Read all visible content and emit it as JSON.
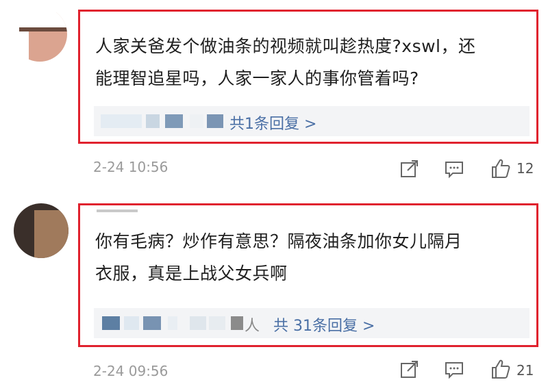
{
  "comments": [
    {
      "text_line1": "人家关爸发个做油条的视频就叫趁热度?xswl，还",
      "text_line2": "能理智追星吗，人家一家人的事你管着吗?",
      "reply_link": "共1条回复 >",
      "timestamp": "2-24 10:56",
      "like_count": "12"
    },
    {
      "text_line1": "你有毛病？炒作有意思？隔夜油条加你女儿隔月",
      "text_line2": "衣服，真是上战父女兵啊",
      "reply_name_tail": "人",
      "reply_link": "共 31条回复 >",
      "timestamp": "2-24 09:56",
      "like_count": "21"
    }
  ],
  "colors": {
    "highlight_border": "#e0222e",
    "reply_link": "#4a6fa5",
    "meta_text": "#9a9a9a",
    "reply_bg": "#f3f4f6",
    "avatar1": "#dba490",
    "avatar2": "#a07a5c"
  },
  "icons": [
    "share-icon",
    "comment-icon",
    "thumbs-up-icon"
  ]
}
